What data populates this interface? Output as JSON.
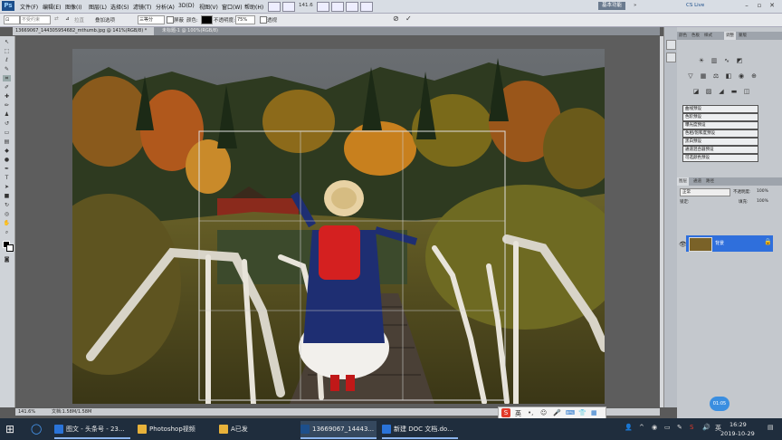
{
  "colors": {
    "accent": "#2f6fdc",
    "taskbar": "#1f2d3d",
    "ps_blue": "#1d4f8b"
  },
  "menubar": {
    "logo": "Ps",
    "items": [
      "文件(F)",
      "编辑(E)",
      "图像(I)",
      "图层(L)",
      "选择(S)",
      "滤镜(T)",
      "分析(A)",
      "3D(D)",
      "视图(V)",
      "窗口(W)",
      "帮助(H)"
    ],
    "zoom": "141.6",
    "workspace_button": "基本功能",
    "cs_live": "CS Live"
  },
  "options": {
    "ratio": "不受约束",
    "rotate_label": "拉直",
    "overlay_label": "叠加选项",
    "overlay_value": "三等分",
    "shield_label": "屏蔽",
    "color_label": "颜色:",
    "opacity_label": "不透明度:",
    "opacity_value": "75%",
    "perspective_label": "透视"
  },
  "tabs": [
    {
      "label": "13669067_1443059546​82_mthumb.jpg @ 141%(RGB/8) *"
    },
    {
      "label": "未标题-1 @ 100%(RGB/8)"
    }
  ],
  "status": {
    "zoom": "141.6%",
    "doc": "文档:1.58M/1.58M"
  },
  "panels": {
    "top_tabs": [
      "颜色",
      "色板",
      "样式",
      "调整",
      "蒙版"
    ],
    "presets": [
      "曲线预设",
      "色阶预设",
      "曝光度预设",
      "色相/饱和度预设",
      "黑白预设",
      "通道混合器预设",
      "可选颜色预设"
    ],
    "layer_tabs": [
      "图层",
      "通道",
      "路径"
    ],
    "blend_mode": "正常",
    "opacity_label": "不透明度:",
    "opacity_value": "100%",
    "lock_label": "锁定:",
    "fill_label": "填充:",
    "fill_value": "100%",
    "layer_name": "背景"
  },
  "taskbar": {
    "items": [
      {
        "label": "图文 - 头条号 - 23...",
        "color": "#2a73d8"
      },
      {
        "label": "Photoshop视频",
        "color": "#e8b23a"
      },
      {
        "label": "A已发",
        "color": "#e8b23a"
      },
      {
        "label": "13669067_14443...",
        "color": "#1d4f8b"
      },
      {
        "label": "新建 DOC 文档.do...",
        "color": "#2a73d8"
      }
    ],
    "time": "16:29",
    "date": "2019-10-29",
    "ime": "英",
    "floating_badge": "01:05"
  }
}
